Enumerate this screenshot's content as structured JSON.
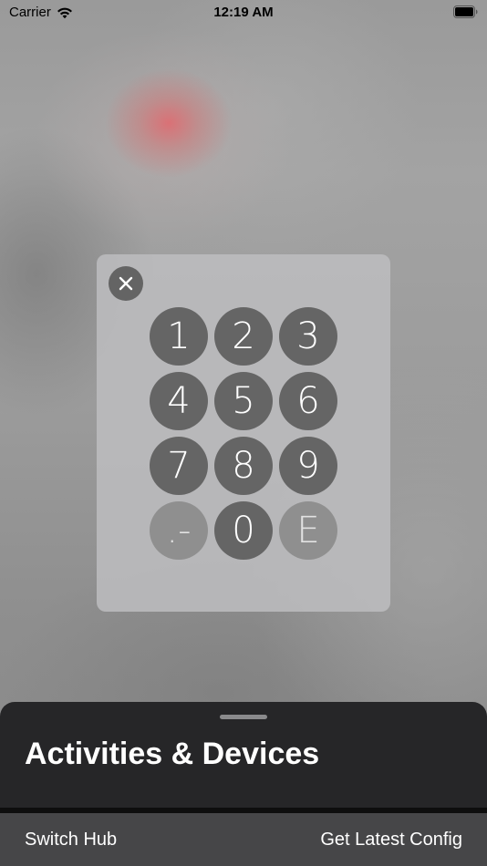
{
  "status_bar": {
    "carrier": "Carrier",
    "time": "12:19 AM"
  },
  "keypad": {
    "close_icon": "close-icon",
    "keys": [
      {
        "label": "1",
        "enabled": true
      },
      {
        "label": "2",
        "enabled": true
      },
      {
        "label": "3",
        "enabled": true
      },
      {
        "label": "4",
        "enabled": true
      },
      {
        "label": "5",
        "enabled": true
      },
      {
        "label": "6",
        "enabled": true
      },
      {
        "label": "7",
        "enabled": true
      },
      {
        "label": "8",
        "enabled": true
      },
      {
        "label": "9",
        "enabled": true
      },
      {
        "label": ".-",
        "enabled": false
      },
      {
        "label": "0",
        "enabled": true
      },
      {
        "label": "E",
        "enabled": false
      }
    ]
  },
  "sheet": {
    "title": "Activities & Devices"
  },
  "toolbar": {
    "switch_hub_label": "Switch Hub",
    "get_latest_config_label": "Get Latest Config"
  },
  "colors": {
    "key_enabled": "#656565",
    "key_disabled": "#8f8f8f",
    "sheet_background": "#262628",
    "toolbar_background": "#464648",
    "accent_blur": "#dc6e73"
  }
}
